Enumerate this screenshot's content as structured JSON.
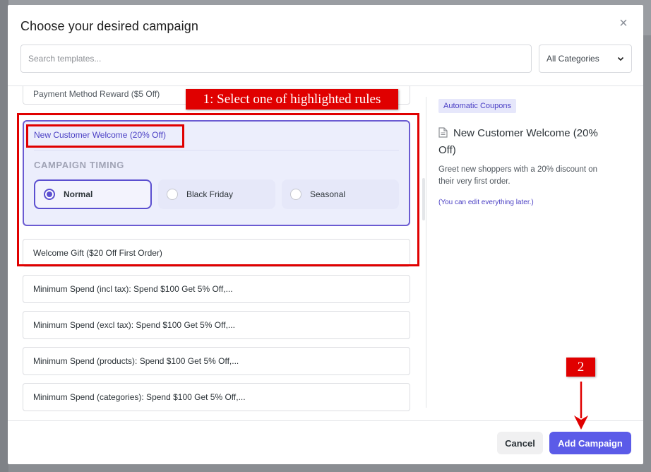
{
  "modal": {
    "title": "Choose your desired campaign",
    "close_glyph": "×",
    "search_placeholder": "Search templates...",
    "category_select": "All Categories"
  },
  "templates": {
    "partial_item": "Payment Method Reward ($5 Off)",
    "active": {
      "label": "New Customer Welcome (20% Off)",
      "timing_heading": "CAMPAIGN TIMING",
      "options": [
        {
          "label": "Normal",
          "selected": true
        },
        {
          "label": "Black Friday",
          "selected": false
        },
        {
          "label": "Seasonal",
          "selected": false
        }
      ]
    },
    "items": [
      "Welcome Gift ($20 Off First Order)",
      "Minimum Spend (incl tax): Spend $100 Get 5% Off,...",
      "Minimum Spend (excl tax): Spend $100 Get 5% Off,...",
      "Minimum Spend (products): Spend $100 Get 5% Off,...",
      "Minimum Spend (categories): Spend $100 Get 5% Off,..."
    ]
  },
  "detail": {
    "badge": "Automatic Coupons",
    "title": "New Customer Welcome (20% Off)",
    "description": "Greet new shoppers with a 20% discount on their very first order.",
    "note": "(You can edit everything later.)"
  },
  "footer": {
    "cancel_label": "Cancel",
    "add_label": "Add Campaign"
  },
  "annotations": {
    "step1": "1: Select one of highlighted rules",
    "step2": "2"
  },
  "colors": {
    "accent": "#5b5be8",
    "selected_border": "#6b5bd2",
    "annotation": "#e00000"
  },
  "icons": {
    "close": "close-icon",
    "chevron": "chevron-down-icon",
    "document": "document-icon",
    "arrow": "arrow-down-icon"
  }
}
